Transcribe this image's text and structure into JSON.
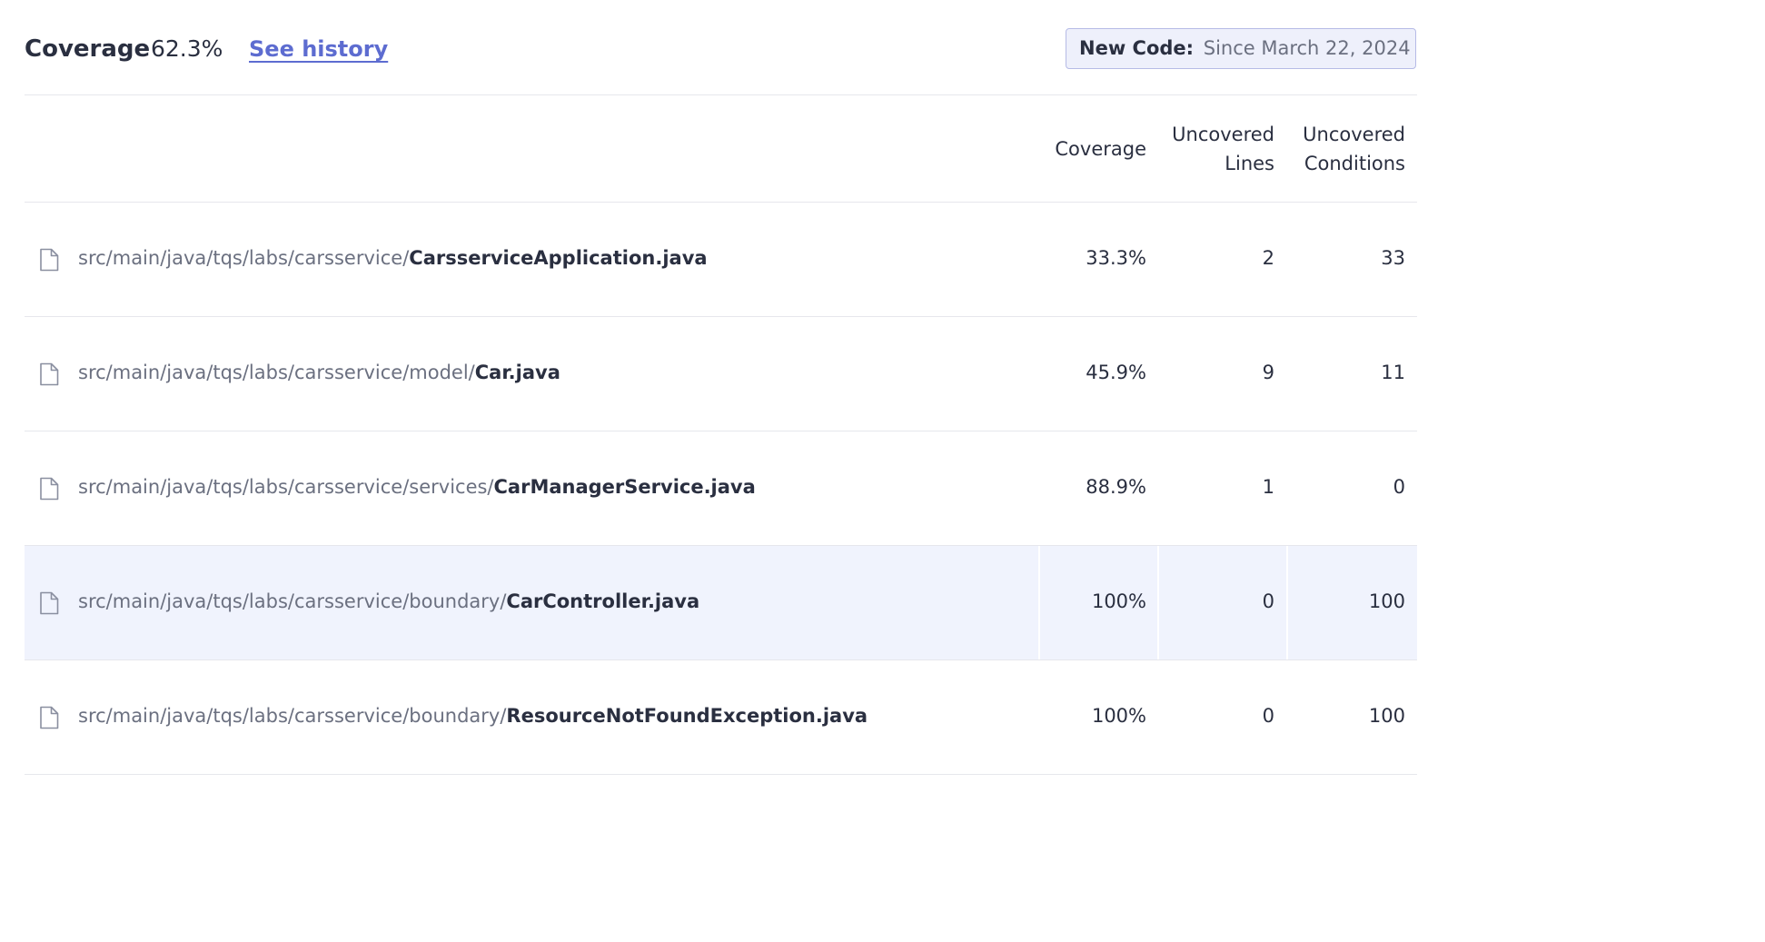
{
  "header": {
    "metric_title": "Coverage",
    "metric_value": "62.3%",
    "history_link": "See history",
    "new_code_label": "New Code:",
    "new_code_value": "Since March 22, 2024"
  },
  "table": {
    "columns": {
      "coverage": "Coverage",
      "uncovered_lines_1": "Uncovered",
      "uncovered_lines_2": "Lines",
      "uncovered_conditions_1": "Uncovered",
      "uncovered_conditions_2": "Conditions"
    },
    "rows": [
      {
        "dir": "src/main/java/tqs/labs/carsservice/",
        "name": "CarsserviceApplication.java",
        "coverage": "33.3%",
        "uncovered_lines": "2",
        "uncovered_conditions": "33",
        "highlighted": false
      },
      {
        "dir": "src/main/java/tqs/labs/carsservice/model/",
        "name": "Car.java",
        "coverage": "45.9%",
        "uncovered_lines": "9",
        "uncovered_conditions": "11",
        "highlighted": false
      },
      {
        "dir": "src/main/java/tqs/labs/carsservice/services/",
        "name": "CarManagerService.java",
        "coverage": "88.9%",
        "uncovered_lines": "1",
        "uncovered_conditions": "0",
        "highlighted": false
      },
      {
        "dir": "src/main/java/tqs/labs/carsservice/boundary/",
        "name": "CarController.java",
        "coverage": "100%",
        "uncovered_lines": "0",
        "uncovered_conditions": "100",
        "highlighted": true
      },
      {
        "dir": "src/main/java/tqs/labs/carsservice/boundary/",
        "name": "ResourceNotFoundException.java",
        "coverage": "100%",
        "uncovered_lines": "0",
        "uncovered_conditions": "100",
        "highlighted": false
      }
    ]
  },
  "icons": {
    "file": "file-icon"
  },
  "colors": {
    "link": "#5d6cd0",
    "highlight_row": "#f0f3fd",
    "new_code_bg": "#eef0fb",
    "new_code_border": "#b6bbe6"
  }
}
